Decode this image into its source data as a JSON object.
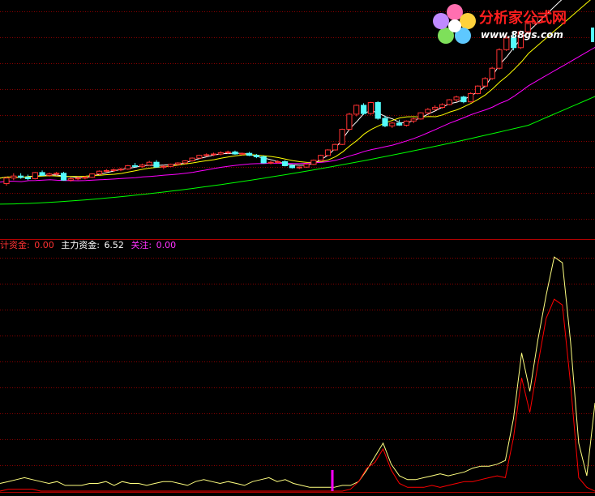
{
  "logo": {
    "name": "分析家公式网",
    "url": "www.88gs.com"
  },
  "indicator_legend": {
    "items": [
      {
        "label": "计资金:",
        "value": "0.00",
        "label_color": "#ff3232",
        "value_color": "#ff3232"
      },
      {
        "label": "主力资金:",
        "value": "6.52",
        "label_color": "#ffffff",
        "value_color": "#ffffff"
      },
      {
        "label": "关注:",
        "value": "0.00",
        "label_color": "#ff32ff",
        "value_color": "#ff32ff"
      }
    ]
  },
  "colors": {
    "up_candle": "#ff3232",
    "down_candle": "#54fcfc",
    "grid": "#8b0000",
    "ma_short": "#ffffff",
    "ma_mid": "#ffff00",
    "ma_long": "#ff00ff",
    "ma_longest": "#00ff00",
    "main_fund": "#ffff80",
    "calc_fund": "#ff0000",
    "focus": "#ff00ff"
  },
  "chart_data": [
    {
      "type": "candlestick",
      "title": "",
      "candles": [
        [
          12.5,
          13.5,
          12.2,
          13.3
        ],
        [
          13.3,
          14.0,
          13.0,
          13.6
        ],
        [
          13.6,
          14.0,
          13.2,
          13.4
        ],
        [
          13.4,
          13.8,
          13.0,
          13.2
        ],
        [
          13.2,
          14.2,
          13.1,
          14.1
        ],
        [
          14.1,
          14.4,
          13.6,
          13.7
        ],
        [
          13.7,
          14.1,
          13.5,
          13.9
        ],
        [
          13.9,
          14.2,
          13.7,
          14.0
        ],
        [
          14.0,
          14.2,
          12.9,
          13.0
        ],
        [
          13.0,
          13.4,
          12.8,
          13.2
        ],
        [
          13.2,
          13.5,
          13.0,
          13.3
        ],
        [
          13.3,
          13.6,
          13.1,
          13.4
        ],
        [
          13.4,
          14.0,
          13.3,
          13.9
        ],
        [
          13.9,
          14.4,
          13.8,
          14.3
        ],
        [
          14.3,
          14.6,
          14.1,
          14.4
        ],
        [
          14.4,
          14.7,
          14.2,
          14.5
        ],
        [
          14.5,
          14.8,
          14.3,
          14.6
        ],
        [
          14.6,
          15.2,
          14.5,
          15.1
        ],
        [
          15.1,
          15.5,
          14.9,
          15.0
        ],
        [
          15.0,
          15.4,
          14.8,
          15.2
        ],
        [
          15.2,
          15.8,
          15.1,
          15.6
        ],
        [
          15.6,
          15.9,
          14.8,
          14.9
        ],
        [
          14.9,
          15.2,
          14.6,
          15.0
        ],
        [
          15.0,
          15.4,
          14.9,
          15.3
        ],
        [
          15.3,
          15.6,
          15.1,
          15.5
        ],
        [
          15.5,
          15.9,
          15.3,
          15.8
        ],
        [
          15.8,
          16.3,
          15.7,
          16.2
        ],
        [
          16.2,
          16.7,
          16.1,
          16.6
        ],
        [
          16.6,
          16.9,
          16.4,
          16.7
        ],
        [
          16.7,
          17.0,
          16.5,
          16.8
        ],
        [
          16.8,
          17.2,
          16.6,
          17.0
        ],
        [
          17.0,
          17.3,
          16.8,
          17.1
        ],
        [
          17.1,
          17.3,
          16.7,
          16.8
        ],
        [
          16.8,
          17.0,
          16.6,
          16.9
        ],
        [
          16.9,
          17.1,
          16.5,
          16.6
        ],
        [
          16.6,
          16.8,
          16.2,
          16.4
        ],
        [
          16.4,
          16.6,
          15.4,
          15.5
        ],
        [
          15.5,
          15.8,
          15.3,
          15.6
        ],
        [
          15.6,
          15.9,
          15.4,
          15.7
        ],
        [
          15.7,
          15.9,
          15.0,
          15.1
        ],
        [
          15.1,
          15.3,
          14.7,
          14.8
        ],
        [
          14.8,
          15.0,
          14.6,
          14.9
        ],
        [
          14.9,
          15.4,
          14.8,
          15.3
        ],
        [
          15.3,
          16.0,
          15.2,
          15.9
        ],
        [
          15.9,
          16.7,
          15.8,
          16.6
        ],
        [
          16.6,
          17.5,
          16.5,
          17.4
        ],
        [
          17.4,
          18.3,
          17.3,
          18.2
        ],
        [
          18.2,
          20.5,
          18.1,
          20.4
        ],
        [
          20.4,
          22.8,
          20.2,
          22.6
        ],
        [
          22.6,
          24.0,
          22.3,
          23.9
        ],
        [
          23.9,
          24.2,
          22.5,
          22.7
        ],
        [
          22.7,
          24.4,
          22.5,
          24.3
        ],
        [
          24.3,
          24.5,
          21.8,
          22.0
        ],
        [
          22.0,
          22.4,
          20.7,
          20.9
        ],
        [
          20.9,
          21.5,
          20.6,
          21.3
        ],
        [
          21.3,
          21.8,
          20.9,
          21.0
        ],
        [
          21.0,
          21.7,
          20.8,
          21.6
        ],
        [
          21.6,
          22.1,
          21.3,
          21.9
        ],
        [
          21.9,
          22.9,
          21.8,
          22.8
        ],
        [
          22.8,
          23.5,
          22.6,
          23.3
        ],
        [
          23.3,
          23.9,
          23.1,
          23.6
        ],
        [
          23.6,
          24.2,
          23.4,
          24.0
        ],
        [
          24.0,
          24.8,
          23.9,
          24.7
        ],
        [
          24.7,
          25.3,
          24.4,
          25.1
        ],
        [
          25.1,
          25.3,
          24.2,
          24.4
        ],
        [
          24.4,
          25.8,
          24.3,
          25.6
        ],
        [
          25.6,
          26.8,
          25.5,
          26.7
        ],
        [
          26.7,
          28.0,
          26.5,
          27.8
        ],
        [
          27.8,
          29.5,
          27.6,
          29.3
        ],
        [
          29.3,
          32.2,
          29.1,
          32.0
        ],
        [
          32.0,
          34.0,
          31.8,
          33.7
        ],
        [
          33.7,
          34.5,
          31.9,
          32.3
        ],
        [
          32.3,
          34.8,
          32.1,
          34.6
        ],
        [
          34.6,
          36.0,
          34.3,
          35.8
        ],
        [
          35.8,
          37.0,
          35.5,
          36.8
        ]
      ],
      "moving_averages": [
        "ma_short",
        "ma_mid",
        "ma_long",
        "ma_longest"
      ]
    },
    {
      "type": "line",
      "title": "",
      "series": [
        {
          "name": "主力资金",
          "values": [
            0.4,
            0.5,
            0.6,
            0.7,
            0.6,
            0.5,
            0.4,
            0.5,
            0.3,
            0.3,
            0.3,
            0.4,
            0.4,
            0.5,
            0.3,
            0.5,
            0.4,
            0.4,
            0.3,
            0.4,
            0.5,
            0.5,
            0.4,
            0.3,
            0.5,
            0.6,
            0.5,
            0.4,
            0.5,
            0.4,
            0.3,
            0.5,
            0.6,
            0.7,
            0.5,
            0.6,
            0.4,
            0.3,
            0.2,
            0.2,
            0.2,
            0.2,
            0.3,
            0.3,
            0.5,
            1.1,
            1.8,
            2.5,
            1.4,
            0.8,
            0.6,
            0.6,
            0.7,
            0.8,
            0.9,
            0.8,
            0.9,
            1.0,
            1.2,
            1.3,
            1.3,
            1.4,
            1.6,
            3.8,
            7.2,
            5.2,
            7.9,
            10.2,
            12.2,
            11.9,
            7.8,
            2.5,
            0.8,
            4.6
          ]
        },
        {
          "name": "计资金",
          "values": [
            0.0,
            0.1,
            0.1,
            0.1,
            0.1,
            0.0,
            0.0,
            0.0,
            0.0,
            0.0,
            0.0,
            0.0,
            0.0,
            0.0,
            0.0,
            0.0,
            0.0,
            0.0,
            0.0,
            0.0,
            0.0,
            0.0,
            0.0,
            0.0,
            0.0,
            0.0,
            0.0,
            0.0,
            0.0,
            0.0,
            0.0,
            0.0,
            0.0,
            0.0,
            0.0,
            0.0,
            0.0,
            0.0,
            0.0,
            0.0,
            0.0,
            0.0,
            0.0,
            0.1,
            0.5,
            1.2,
            1.5,
            2.2,
            1.1,
            0.4,
            0.2,
            0.2,
            0.2,
            0.3,
            0.2,
            0.3,
            0.4,
            0.5,
            0.5,
            0.6,
            0.7,
            0.8,
            0.7,
            2.8,
            5.9,
            4.1,
            6.6,
            9.0,
            10.0,
            9.7,
            5.6,
            0.7,
            0.2,
            0.0
          ]
        }
      ],
      "focus_markers": [
        42
      ]
    }
  ]
}
